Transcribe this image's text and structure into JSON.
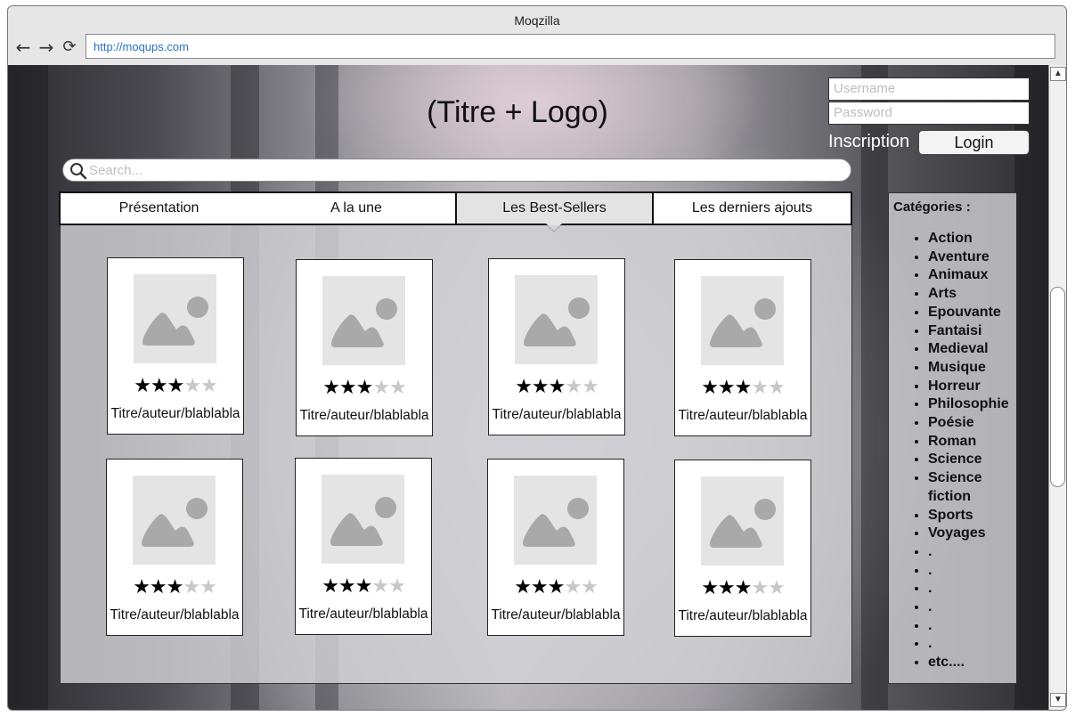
{
  "browser": {
    "title": "Moqzilla",
    "url": "http://moqups.com",
    "back_icon": "arrow-left-icon",
    "forward_icon": "arrow-right-icon",
    "reload_icon": "reload-icon"
  },
  "header": {
    "site_title": "(Titre + Logo)"
  },
  "login": {
    "username_placeholder": "Username",
    "password_placeholder": "Password",
    "inscription_label": "Inscription",
    "login_label": "Login"
  },
  "search": {
    "placeholder": "Search..."
  },
  "tabs": [
    {
      "label": "Présentation",
      "active": false
    },
    {
      "label": "A la une",
      "active": false
    },
    {
      "label": "Les Best-Sellers",
      "active": true
    },
    {
      "label": "Les derniers ajouts",
      "active": false
    }
  ],
  "books": [
    {
      "caption": "Titre/auteur/blablabla",
      "rating": 3,
      "max_rating": 5
    },
    {
      "caption": "Titre/auteur/blablabla",
      "rating": 3,
      "max_rating": 5
    },
    {
      "caption": "Titre/auteur/blablabla",
      "rating": 3,
      "max_rating": 5
    },
    {
      "caption": "Titre/auteur/blablabla",
      "rating": 3,
      "max_rating": 5
    },
    {
      "caption": "Titre/auteur/blablabla",
      "rating": 3,
      "max_rating": 5
    },
    {
      "caption": "Titre/auteur/blablabla",
      "rating": 3,
      "max_rating": 5
    },
    {
      "caption": "Titre/auteur/blablabla",
      "rating": 3,
      "max_rating": 5
    },
    {
      "caption": "Titre/auteur/blablabla",
      "rating": 3,
      "max_rating": 5
    }
  ],
  "categories": {
    "heading": "Catégories :",
    "items": [
      "Action",
      "Aventure",
      "Animaux",
      "Arts",
      "Epouvante",
      "Fantaisi",
      "Medieval",
      "Musique",
      "Horreur",
      "Philosophie",
      "Poésie",
      "Roman",
      "Science",
      "Science fiction",
      "Sports",
      "Voyages",
      ".",
      ".",
      ".",
      ".",
      ".",
      ".",
      "etc...."
    ]
  }
}
